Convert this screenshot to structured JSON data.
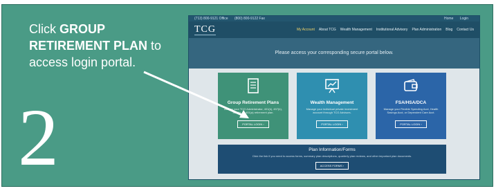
{
  "instruction": {
    "prefix": "Click ",
    "bold": "GROUP RETIREMENT PLAN",
    "suffix": " to access login portal."
  },
  "step_number": "2",
  "website": {
    "topbar_left": [
      "(713) 800-9121 Office",
      "(800) 800-9122 Fax"
    ],
    "topbar_right": [
      "Home",
      "Login"
    ],
    "logo": "TCG",
    "nav": [
      "My Account",
      "About TCG",
      "Wealth Management",
      "Institutional Advisory",
      "Plan Administration",
      "Blog",
      "Contact Us"
    ],
    "hero_text": "Please access your corresponding secure portal below.",
    "cards": [
      {
        "title": "Group Retirement Plans",
        "desc": "Access your TCG Administrator, 401(k), 457(b), 403(b), or 401(a) retirement plan.",
        "button": "PORTAL LOGIN ›",
        "icon": "document-icon"
      },
      {
        "title": "Wealth Management",
        "desc": "Manage your individual private investment account through TCG Advisors.",
        "button": "PORTAL LOGIN ›",
        "icon": "chart-board-icon"
      },
      {
        "title": "FSA/HSA/DCA",
        "desc": "Manage your Flexible Spending Acct, Health Savings Acct, or Dependent Care Acct.",
        "button": "PORTAL LOGIN ›",
        "icon": "wallet-icon"
      }
    ],
    "plan_info": {
      "title": "Plan Information/Forms",
      "desc": "Click the link if you need to access forms, summary plan descriptions, quarterly plan reviews, and other important plan documents.",
      "button": "ACCESS FORMS ›"
    }
  }
}
